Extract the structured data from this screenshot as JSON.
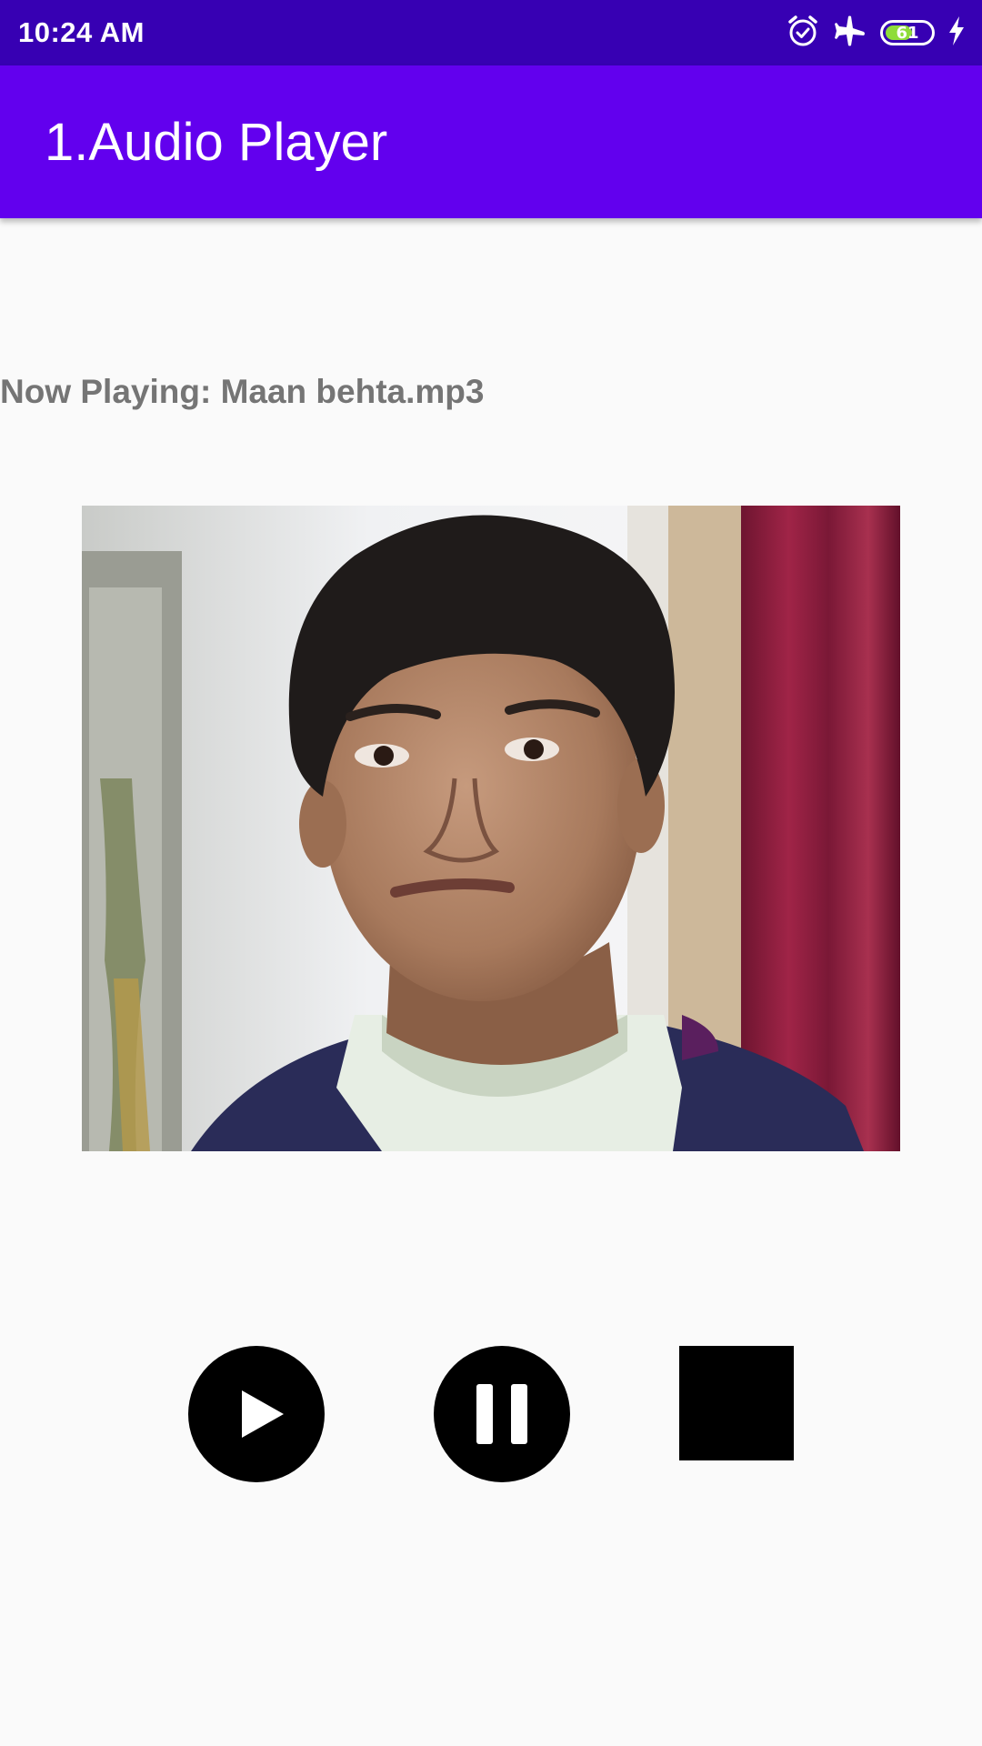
{
  "status_bar": {
    "time": "10:24 AM",
    "battery_level": "61",
    "battery_fraction": 0.61,
    "icons": [
      "alarm-icon",
      "airplane-mode-icon",
      "battery-icon",
      "charging-bolt-icon"
    ]
  },
  "app_bar": {
    "title": "1.Audio Player",
    "color": "#6200ee",
    "status_color": "#3700b3"
  },
  "player": {
    "now_playing": "Now Playing: Maan behta.mp3"
  },
  "controls": {
    "play_icon": "play-icon",
    "pause_icon": "pause-icon",
    "stop_icon": "stop-icon"
  }
}
